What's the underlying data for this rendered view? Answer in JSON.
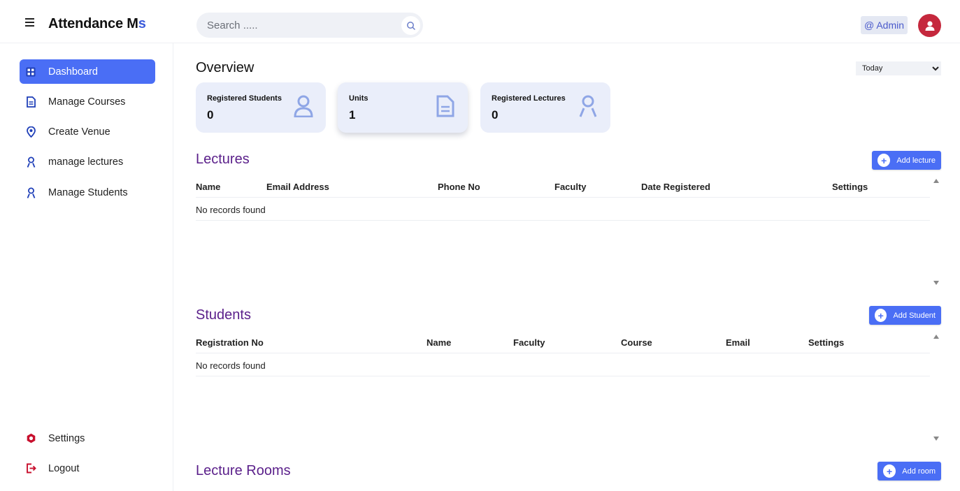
{
  "app": {
    "brand_main": "Attendance M",
    "brand_accent": "s",
    "search_placeholder": "Search .....",
    "admin_label": "@ Admin"
  },
  "sidebar": {
    "items": [
      {
        "label": "Dashboard",
        "icon": "dashboard-icon",
        "active": true
      },
      {
        "label": "Manage Courses",
        "icon": "document-icon"
      },
      {
        "label": "Create Venue",
        "icon": "location-pin-icon"
      },
      {
        "label": "manage lectures",
        "icon": "person-icon"
      },
      {
        "label": "Manage Students",
        "icon": "person-icon"
      }
    ],
    "bottom": [
      {
        "label": "Settings",
        "icon": "gear-icon"
      },
      {
        "label": "Logout",
        "icon": "logout-icon"
      }
    ]
  },
  "overview": {
    "title": "Overview",
    "period": "Today",
    "cards": [
      {
        "label": "Registered Students",
        "value": "0",
        "icon": "person-icon"
      },
      {
        "label": "Units",
        "value": "1",
        "icon": "document-icon"
      },
      {
        "label": "Registered Lectures",
        "value": "0",
        "icon": "person-icon"
      }
    ]
  },
  "lectures": {
    "title": "Lectures",
    "add_label": "Add lecture",
    "columns": [
      "Name",
      "Email Address",
      "Phone No",
      "Faculty",
      "Date Registered",
      "Settings"
    ],
    "empty_text": "No records found"
  },
  "students": {
    "title": "Students",
    "add_label": "Add Student",
    "columns": [
      "Registration No",
      "Name",
      "Faculty",
      "Course",
      "Email",
      "Settings"
    ],
    "empty_text": "No records found"
  },
  "rooms": {
    "title": "Lecture Rooms",
    "add_label": "Add room"
  },
  "colors": {
    "accent": "#4a6ef5",
    "section_title": "#5a1f8a",
    "card_bg": "#eaeefa",
    "icon_tint": "#8fa6e6",
    "avatar": "#c5283d",
    "danger_icon": "#c8102e"
  }
}
